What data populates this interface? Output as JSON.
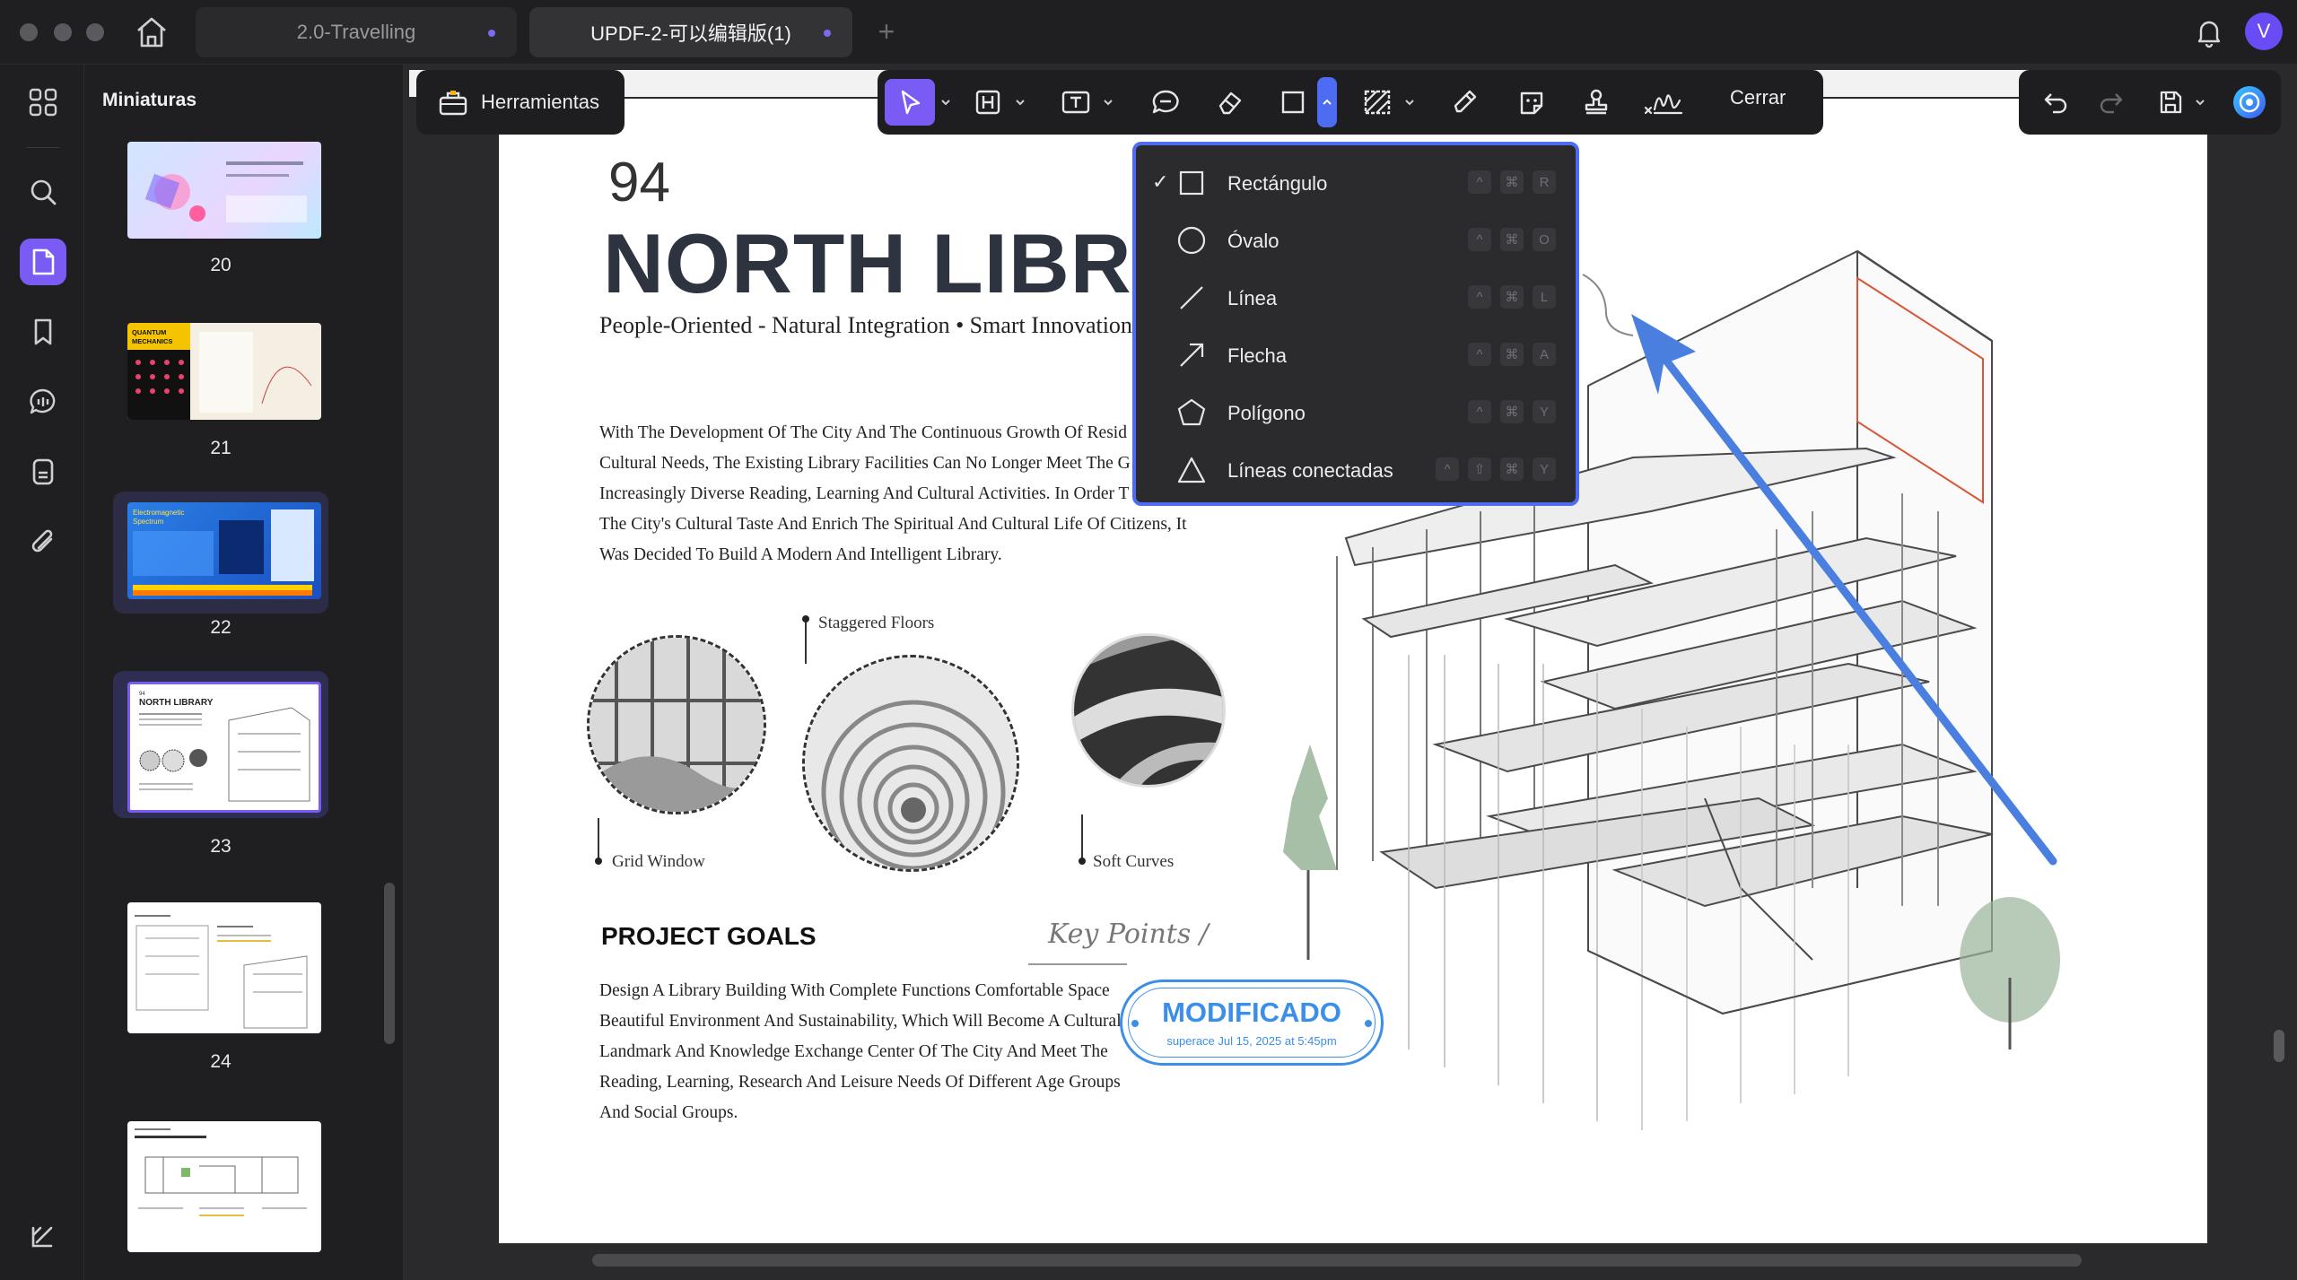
{
  "window": {
    "tabs": [
      {
        "label": "2.0-Travelling"
      },
      {
        "label": "UPDF-2-可以编辑版(1)"
      }
    ],
    "avatar_initial": "V"
  },
  "sidebar": {
    "title": "Miniaturas",
    "thumbnails": [
      {
        "page": "20"
      },
      {
        "page": "21",
        "mini_text": "QUANTUM MECHANICS"
      },
      {
        "page": "22",
        "mini_text": "Electromagnetic Spectrum"
      },
      {
        "page": "23",
        "mini_text": "NORTH LIBRARY"
      },
      {
        "page": "24"
      },
      {
        "page": ""
      }
    ]
  },
  "toolbar": {
    "tools_label": "Herramientas",
    "close_label": "Cerrar"
  },
  "shape_menu": {
    "items": [
      {
        "label": "Rectángulo",
        "checked": "✓",
        "keys": [
          "^",
          "⌘",
          "R"
        ]
      },
      {
        "label": "Óvalo",
        "keys": [
          "^",
          "⌘",
          "O"
        ]
      },
      {
        "label": "Línea",
        "keys": [
          "^",
          "⌘",
          "L"
        ]
      },
      {
        "label": "Flecha",
        "keys": [
          "^",
          "⌘",
          "A"
        ]
      },
      {
        "label": "Polígono",
        "keys": [
          "^",
          "⌘",
          "Y"
        ]
      },
      {
        "label": "Líneas conectadas",
        "keys": [
          "^",
          "⇧",
          "⌘",
          "Y"
        ]
      }
    ]
  },
  "document": {
    "page_number": "94",
    "title": "NORTH LIBRARY",
    "subtitle": "People-Oriented - Natural Integration • Smart Innovation",
    "intro_lines": [
      "With The Development Of The City And The Continuous Growth Of Resid",
      "Cultural Needs, The Existing Library Facilities Can No Longer Meet The G",
      "Increasingly Diverse Reading, Learning And Cultural Activities. In Order T",
      "The City's Cultural Taste And Enrich The Spiritual And Cultural Life Of Citizens, It",
      "Was Decided To Build A Modern And Intelligent Library."
    ],
    "captions": {
      "grid_window": "Grid Window",
      "staggered_floors": "Staggered Floors",
      "soft_curves": "Soft Curves"
    },
    "goals_title": "PROJECT GOALS",
    "key_points": "Key Points /",
    "goals_lines": [
      "Design A Library Building With Complete Functions Comfortable Space",
      "Beautiful Environment And Sustainability, Which Will Become A Cultural",
      "Landmark And Knowledge Exchange Center Of The City And Meet The",
      "Reading, Learning, Research And Leisure Needs Of Different Age Groups",
      "And Social Groups."
    ],
    "stamp": {
      "main": "MODIFICADO",
      "sub": "superace Jul 15, 2025 at 5:45pm"
    }
  },
  "colors": {
    "accent": "#7a5cf5",
    "menu_border": "#4d6cf2",
    "stamp": "#3b8fe8",
    "arrow": "#4a7fe0"
  }
}
